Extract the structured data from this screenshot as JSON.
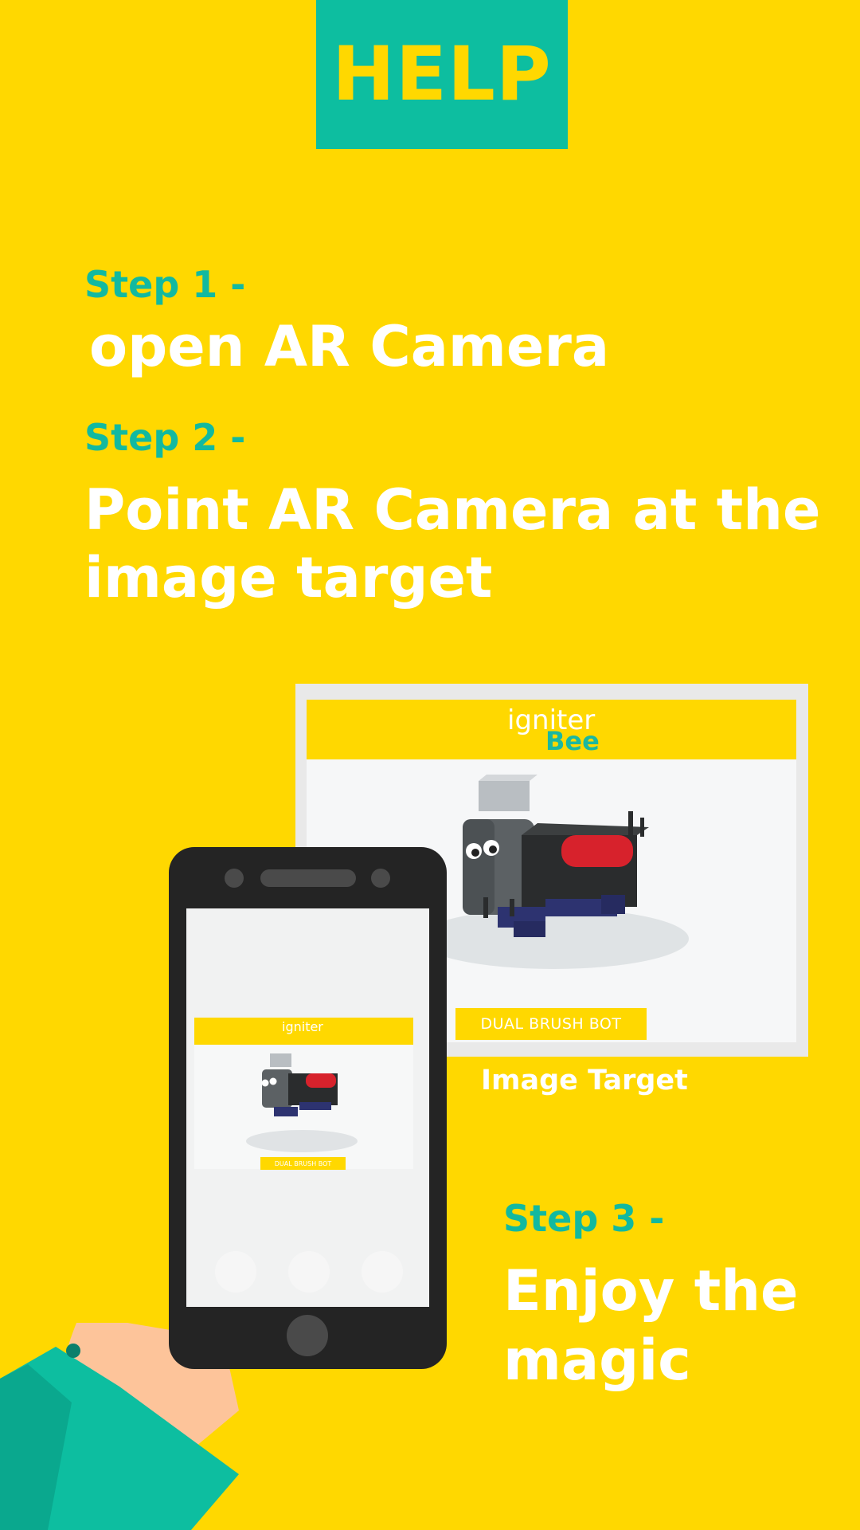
{
  "header": {
    "title": "HELP"
  },
  "steps": {
    "step1": {
      "label": "Step 1 -",
      "text": "open AR Camera"
    },
    "step2": {
      "label": "Step 2 -",
      "line1": "Point AR Camera at the",
      "line2": "image target"
    },
    "step3": {
      "label": "Step 3 -",
      "line1": "Enjoy the",
      "line2": "magic"
    }
  },
  "target": {
    "logo_text": "igniter",
    "logo_sub": "Bee",
    "product_label": "DUAL BRUSH BOT",
    "caption": "Image Target"
  },
  "phone_preview": {
    "logo_text": "igniter",
    "product_label": "DUAL BRUSH BOT"
  },
  "colors": {
    "background": "#FFD800",
    "accent_teal": "#0DBEA0",
    "text_white": "#FFFFFF",
    "phone_dark": "#242424"
  },
  "icons": {
    "robot_illustration": "robot-illustration",
    "phone": "smartphone-icon",
    "hand": "hand-illustration"
  }
}
